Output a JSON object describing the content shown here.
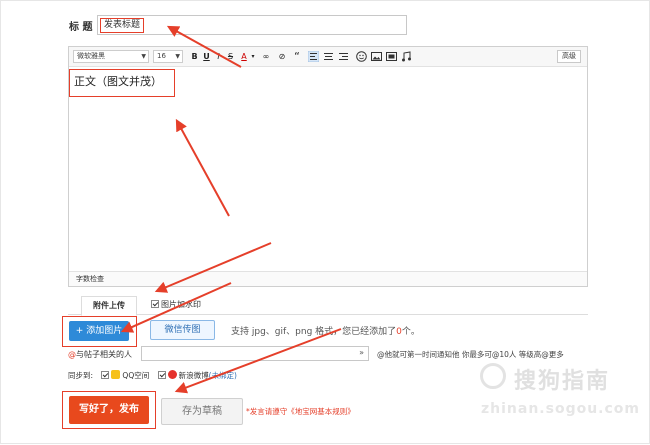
{
  "title_row": {
    "label": "标 题",
    "value": "发表标题"
  },
  "toolbar": {
    "font_family": "微软雅黑",
    "font_size": "16",
    "bold": "B",
    "underline": "U",
    "italic": "I",
    "strike": "S",
    "font_color": "A",
    "link": "∞",
    "unlink": "⊘",
    "quote": "“",
    "advanced": "高级"
  },
  "editor": {
    "body_text": "正文（图文并茂）",
    "word_count": "字数检查"
  },
  "attachments": {
    "tab_upload": "附件上传",
    "watermark_option": "图片加水印",
    "add_image": "+ 添加图片",
    "weixin_image": "微信传图",
    "support_prefix": "支持 jpg、gif、png 格式，您已经添加了",
    "support_count": "0",
    "support_suffix": "个。"
  },
  "relate": {
    "at": "@",
    "label": "与帖子相关的人",
    "hint": "@他就可第一时间通知他 你最多可@10人 等级高@更多"
  },
  "sync": {
    "label": "同步到:",
    "qq": "QQ空间",
    "weibo": "新浪微博",
    "bind": "(未绑定)"
  },
  "actions": {
    "publish": "写好了，发布",
    "draft": "存为草稿",
    "rules": "*发言请遵守《地宝网基本规则》"
  },
  "watermark": {
    "site_name": "搜狗指南",
    "site_url": "zhinan.sogou.com"
  },
  "colors": {
    "annotation_red": "#e53f2a",
    "publish_orange": "#e8491d",
    "add_blue": "#2e8ad8"
  }
}
